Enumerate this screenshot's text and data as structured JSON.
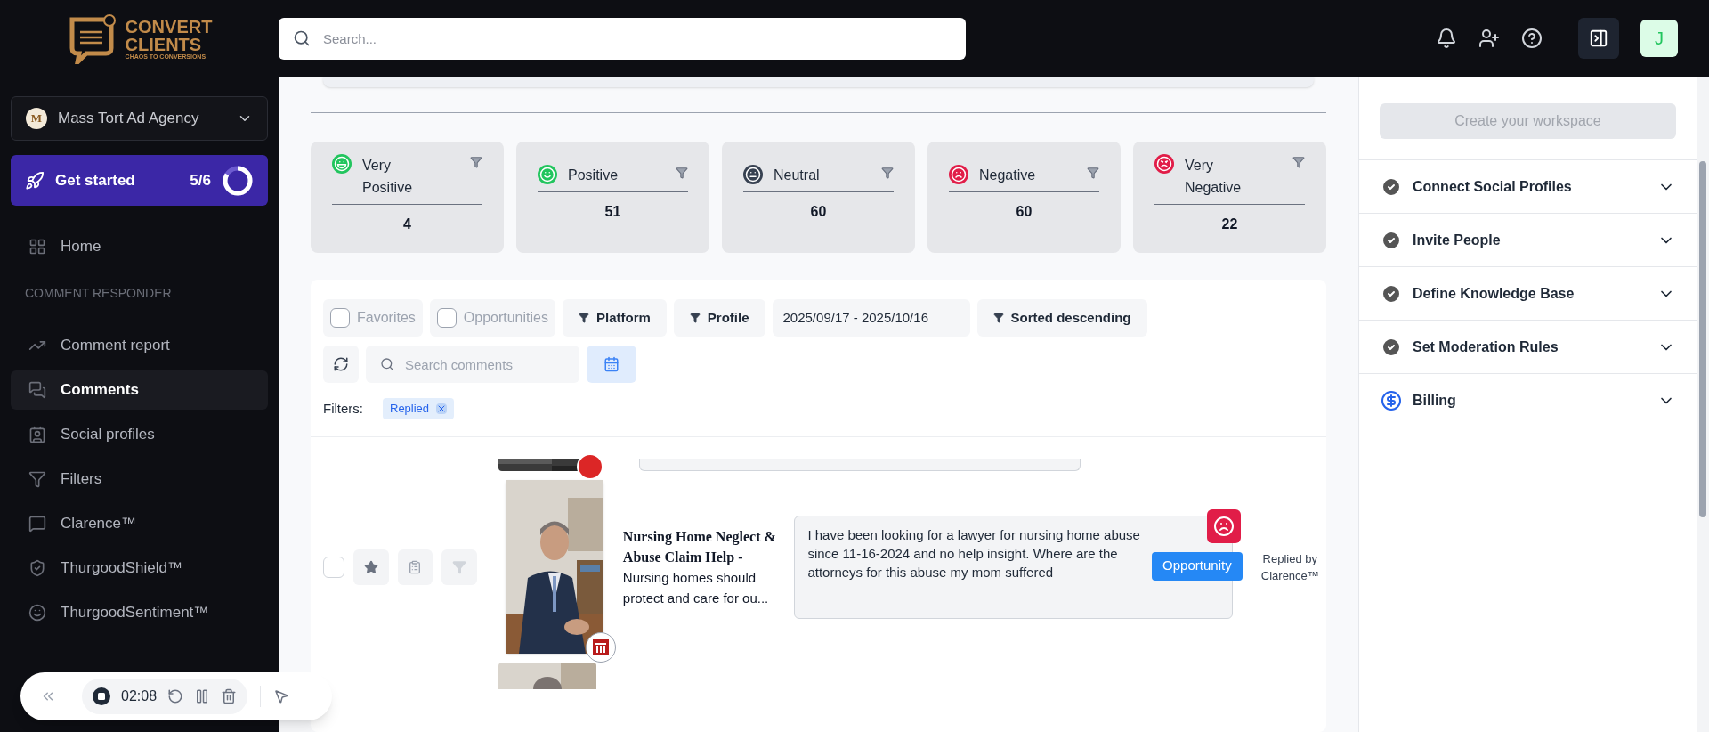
{
  "brand": {
    "line_1": "CONVERT",
    "line_2": "CLIENTS",
    "tagline": "CHAOS TO CONVERSIONS"
  },
  "search": {
    "placeholder": "Search..."
  },
  "header": {
    "avatar": "J"
  },
  "workspace": {
    "name": "Mass Tort Ad Agency",
    "badge": "M"
  },
  "get_started": {
    "label": "Get started",
    "progress": "5/6",
    "level": 0.83
  },
  "sidebar": {
    "home": {
      "label": "Home",
      "selected": false
    },
    "section": "COMMENT RESPONDER",
    "items": [
      {
        "label": "Comment report",
        "selected": false
      },
      {
        "label": "Comments",
        "selected": true
      },
      {
        "label": "Social profiles",
        "selected": false
      },
      {
        "label": "Filters",
        "selected": false
      },
      {
        "label": "Clarence™",
        "selected": false
      },
      {
        "label": "ThurgoodShield™",
        "selected": false
      },
      {
        "label": "ThurgoodSentiment™",
        "selected": false
      }
    ]
  },
  "sentiments": [
    {
      "label": "Very Positive",
      "count": "4",
      "kind": "grin",
      "color": "#22c55e"
    },
    {
      "label": "Positive",
      "count": "51",
      "kind": "smile",
      "color": "#22c55e"
    },
    {
      "label": "Neutral",
      "count": "60",
      "kind": "neutral",
      "color": "#374151"
    },
    {
      "label": "Negative",
      "count": "60",
      "kind": "frown",
      "color": "#e11d48"
    },
    {
      "label": "Very Negative",
      "count": "22",
      "kind": "angry",
      "color": "#e11d48"
    }
  ],
  "toolbar": [
    {
      "kind": "checkbox",
      "label": "Favorites",
      "checked": false
    },
    {
      "kind": "checkbox",
      "label": "Opportunities",
      "checked": false
    },
    {
      "kind": "menu",
      "label": "Platform"
    },
    {
      "kind": "menu",
      "label": "Profile"
    },
    {
      "kind": "date",
      "label": "2025/09/17 - 2025/10/16"
    },
    {
      "kind": "menu",
      "label": "Sorted descending"
    }
  ],
  "comment_search": {
    "placeholder": "Search comments"
  },
  "active_filters": {
    "label": "Filters:",
    "tags": [
      "Replied"
    ]
  },
  "comments": [
    {
      "checked": false,
      "title": "Nursing Home Neglect & Abuse Claim Help -",
      "snippet": "Nursing homes should protect and care for ou...",
      "text": "I have been looking for a lawyer for nursing home abuse since 11-16-2024 and no help insight. Where are the attorneys for this abuse my mom suffered",
      "kind": "frown",
      "badge": "Opportunity",
      "status": "Replied by Clarence™"
    }
  ],
  "setup": {
    "button": {
      "label": "Create your workspace",
      "disabled": true
    },
    "steps": [
      {
        "label": "Connect Social Profiles",
        "kind": "done",
        "expanded": false
      },
      {
        "label": "Invite People",
        "kind": "done",
        "expanded": false
      },
      {
        "label": "Define Knowledge Base",
        "kind": "done",
        "expanded": false
      },
      {
        "label": "Set Moderation Rules",
        "kind": "done",
        "expanded": false
      },
      {
        "label": "Billing",
        "kind": "billing",
        "expanded": false
      }
    ]
  },
  "recorder": {
    "time": "02:08",
    "paused": false
  }
}
